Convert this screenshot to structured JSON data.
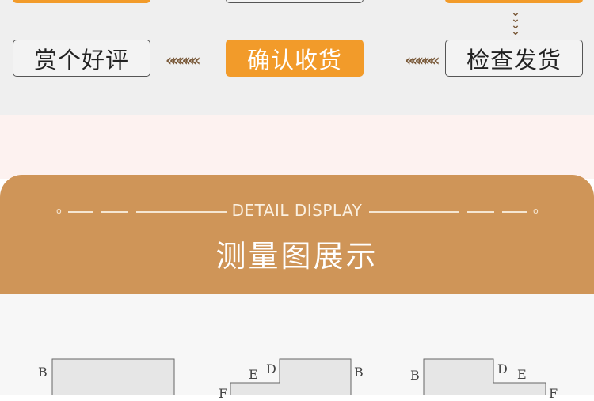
{
  "flow": {
    "steps": {
      "review": "赏个好评",
      "confirm": "确认收货",
      "inspect": "检查发货"
    },
    "arrow_left": "«««««",
    "arrow_down": "⌄⌄⌄⌄"
  },
  "section": {
    "subtitle": "DETAIL DISPLAY",
    "title": "测量图展示",
    "deco_left": "o",
    "deco_right": "o"
  },
  "diagram": {
    "labels": {
      "d1_b": "B",
      "d2_e": "E",
      "d2_d": "D",
      "d2_b": "B",
      "d2_f": "F",
      "d3_b": "B",
      "d3_d": "D",
      "d3_e": "E",
      "d3_f": "F"
    }
  },
  "colors": {
    "accent": "#f29b2a",
    "banner": "#cf9558",
    "arrow": "#7a5a3a"
  }
}
